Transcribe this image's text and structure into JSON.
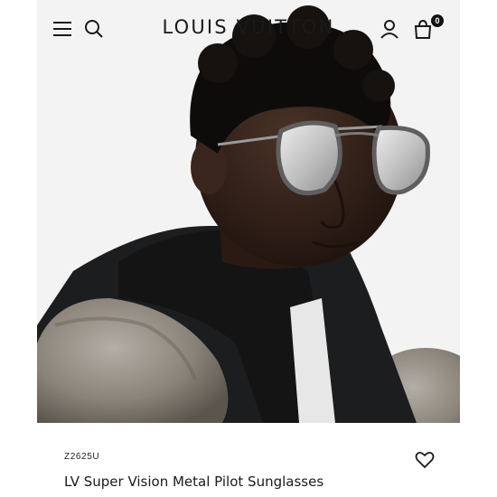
{
  "header": {
    "brand": "LOUIS VUITTON",
    "cart_count": "0"
  },
  "icons": {
    "menu": "menu-icon",
    "search": "search-icon",
    "account": "account-icon",
    "cart": "shopping-bag-icon",
    "wishlist": "heart-icon"
  },
  "product": {
    "sku": "Z2625U",
    "name": "LV Super Vision Metal Pilot Sunglasses"
  },
  "colors": {
    "accent": "#111111",
    "background": "#ffffff"
  }
}
